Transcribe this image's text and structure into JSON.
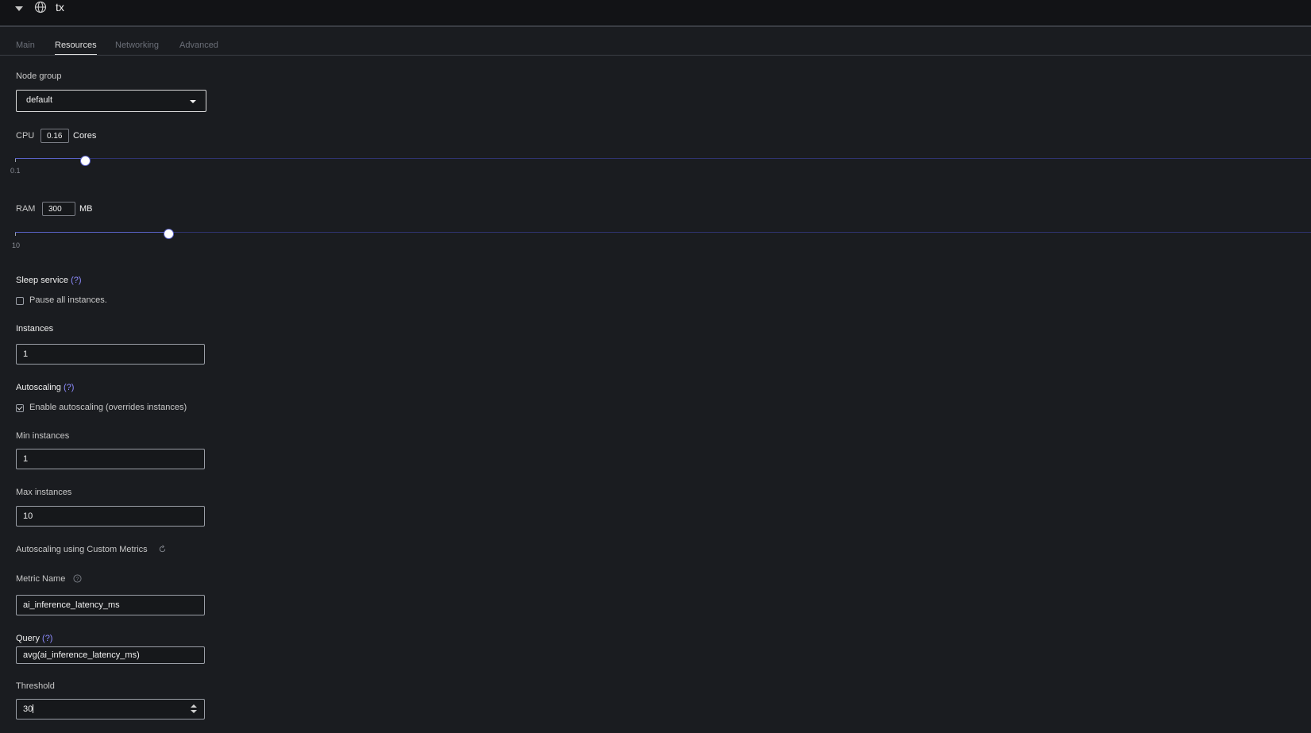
{
  "header": {
    "service_name": "tx",
    "collapse_icon": "chevron-down-icon",
    "service_icon": "globe-icon"
  },
  "tabs": [
    {
      "label": "Main",
      "active": false
    },
    {
      "label": "Resources",
      "active": true
    },
    {
      "label": "Networking",
      "active": false
    },
    {
      "label": "Advanced",
      "active": false
    }
  ],
  "node_group": {
    "label": "Node group",
    "value": "default"
  },
  "cpu": {
    "label": "CPU",
    "value": "0.16",
    "unit": "Cores",
    "min_label": "0.1"
  },
  "ram": {
    "label": "RAM",
    "value": "300",
    "unit": "MB",
    "min_label": "10"
  },
  "sleep": {
    "label": "Sleep service",
    "help": "(?)",
    "checkbox_label": "Pause all instances.",
    "checked": false
  },
  "instances": {
    "label": "Instances",
    "value": "1"
  },
  "autoscaling": {
    "label": "Autoscaling",
    "help": "(?)",
    "checkbox_label": "Enable autoscaling (overrides instances)",
    "checked": true
  },
  "min_instances": {
    "label": "Min instances",
    "value": "1"
  },
  "max_instances": {
    "label": "Max instances",
    "value": "10"
  },
  "custom_metrics": {
    "label": "Autoscaling using Custom Metrics",
    "icon": "refresh-icon"
  },
  "metric_name": {
    "label": "Metric Name",
    "value": "ai_inference_latency_ms",
    "icon": "question-circle-icon"
  },
  "query": {
    "label": "Query",
    "help": "(?)",
    "value": "avg(ai_inference_latency_ms)"
  },
  "threshold": {
    "label": "Threshold",
    "value": "30"
  },
  "colors": {
    "background": "#1a1c20",
    "accent": "#5a62c8",
    "help_link": "#8e8cff"
  }
}
